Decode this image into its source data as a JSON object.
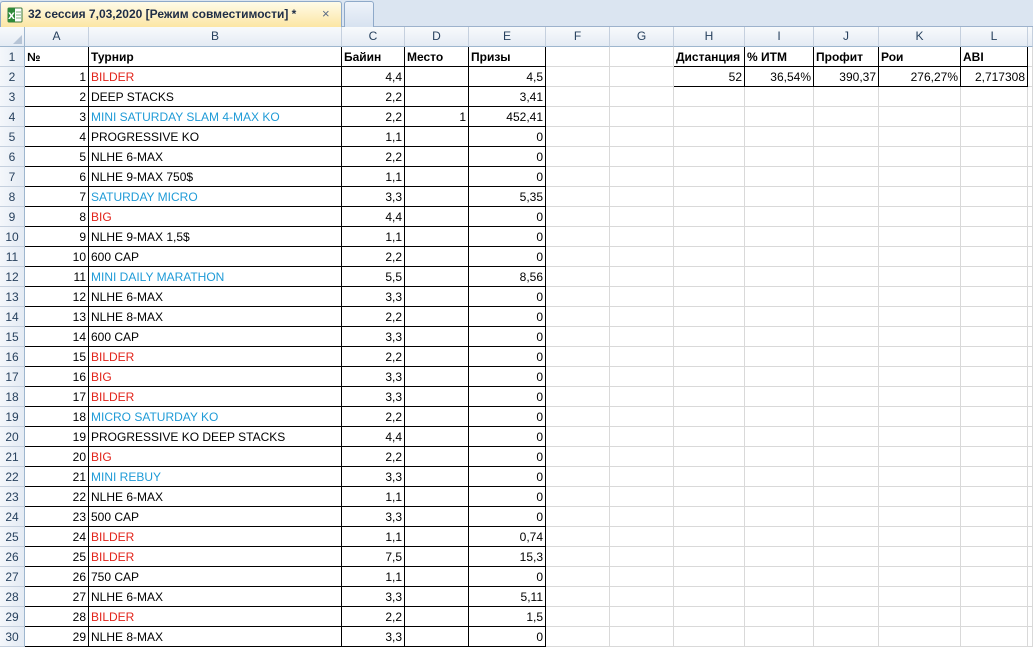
{
  "window": {
    "tab_title": "32 сессия 7,03,2020  [Режим совместимости] *",
    "close_glyph": "×"
  },
  "columns": [
    "A",
    "B",
    "C",
    "D",
    "E",
    "F",
    "G",
    "H",
    "I",
    "J",
    "K",
    "L"
  ],
  "row_numbers": [
    "1",
    "2",
    "3",
    "4",
    "5",
    "6",
    "7",
    "8",
    "9",
    "10",
    "11",
    "12",
    "13",
    "14",
    "15",
    "16",
    "17",
    "18",
    "19",
    "20",
    "21",
    "22",
    "23",
    "24",
    "25",
    "26",
    "27",
    "28",
    "29",
    "30"
  ],
  "table": {
    "headers": [
      "№",
      "Турнир",
      "Байин",
      "Место",
      "Призы"
    ],
    "rows": [
      {
        "n": "1",
        "name": "BILDER",
        "color": "red",
        "buyin": "4,4",
        "place": "",
        "prize": "4,5"
      },
      {
        "n": "2",
        "name": "DEEP STACKS",
        "color": "black",
        "buyin": "2,2",
        "place": "",
        "prize": "3,41"
      },
      {
        "n": "3",
        "name": "MINI SATURDAY SLAM 4-MAX KO",
        "color": "blue",
        "buyin": "2,2",
        "place": "1",
        "prize": "452,41"
      },
      {
        "n": "4",
        "name": "PROGRESSIVE KO",
        "color": "black",
        "buyin": "1,1",
        "place": "",
        "prize": "0"
      },
      {
        "n": "5",
        "name": "NLHE 6-MAX",
        "color": "black",
        "buyin": "2,2",
        "place": "",
        "prize": "0"
      },
      {
        "n": "6",
        "name": "NLHE 9-MAX 750$",
        "color": "black",
        "buyin": "1,1",
        "place": "",
        "prize": "0"
      },
      {
        "n": "7",
        "name": "SATURDAY MICRO",
        "color": "blue",
        "buyin": "3,3",
        "place": "",
        "prize": "5,35"
      },
      {
        "n": "8",
        "name": "BIG",
        "color": "red",
        "buyin": "4,4",
        "place": "",
        "prize": "0"
      },
      {
        "n": "9",
        "name": "NLHE 9-MAX 1,5$",
        "color": "black",
        "buyin": "1,1",
        "place": "",
        "prize": "0"
      },
      {
        "n": "10",
        "name": "600 CAP",
        "color": "black",
        "buyin": "2,2",
        "place": "",
        "prize": "0"
      },
      {
        "n": "11",
        "name": "MINI DAILY MARATHON",
        "color": "blue",
        "buyin": "5,5",
        "place": "",
        "prize": "8,56"
      },
      {
        "n": "12",
        "name": "NLHE 6-MAX",
        "color": "black",
        "buyin": "3,3",
        "place": "",
        "prize": "0"
      },
      {
        "n": "13",
        "name": "NLHE 8-MAX",
        "color": "black",
        "buyin": "2,2",
        "place": "",
        "prize": "0"
      },
      {
        "n": "14",
        "name": "600 CAP",
        "color": "black",
        "buyin": "3,3",
        "place": "",
        "prize": "0"
      },
      {
        "n": "15",
        "name": "BILDER",
        "color": "red",
        "buyin": "2,2",
        "place": "",
        "prize": "0"
      },
      {
        "n": "16",
        "name": "BIG",
        "color": "red",
        "buyin": "3,3",
        "place": "",
        "prize": "0"
      },
      {
        "n": "17",
        "name": "BILDER",
        "color": "red",
        "buyin": "3,3",
        "place": "",
        "prize": "0"
      },
      {
        "n": "18",
        "name": "MICRO SATURDAY KO",
        "color": "blue",
        "buyin": "2,2",
        "place": "",
        "prize": "0"
      },
      {
        "n": "19",
        "name": "PROGRESSIVE KO DEEP STACKS",
        "color": "black",
        "buyin": "4,4",
        "place": "",
        "prize": "0"
      },
      {
        "n": "20",
        "name": "BIG",
        "color": "red",
        "buyin": "2,2",
        "place": "",
        "prize": "0"
      },
      {
        "n": "21",
        "name": "MINI REBUY",
        "color": "blue",
        "buyin": "3,3",
        "place": "",
        "prize": "0"
      },
      {
        "n": "22",
        "name": "NLHE 6-MAX",
        "color": "black",
        "buyin": "1,1",
        "place": "",
        "prize": "0"
      },
      {
        "n": "23",
        "name": "500 CAP",
        "color": "black",
        "buyin": "3,3",
        "place": "",
        "prize": "0"
      },
      {
        "n": "24",
        "name": "BILDER",
        "color": "red",
        "buyin": "1,1",
        "place": "",
        "prize": "0,74"
      },
      {
        "n": "25",
        "name": "BILDER",
        "color": "red",
        "buyin": "7,5",
        "place": "",
        "prize": "15,3"
      },
      {
        "n": "26",
        "name": "750 CAP",
        "color": "black",
        "buyin": "1,1",
        "place": "",
        "prize": "0"
      },
      {
        "n": "27",
        "name": "NLHE 6-MAX",
        "color": "black",
        "buyin": "3,3",
        "place": "",
        "prize": "5,11"
      },
      {
        "n": "28",
        "name": "BILDER",
        "color": "red",
        "buyin": "2,2",
        "place": "",
        "prize": "1,5"
      },
      {
        "n": "29",
        "name": "NLHE 8-MAX",
        "color": "black",
        "buyin": "3,3",
        "place": "",
        "prize": "0"
      }
    ]
  },
  "summary": {
    "headers": [
      "Дистанция",
      "% ИТМ",
      "Профит",
      "Рои",
      "ABI"
    ],
    "values": [
      "52",
      "36,54%",
      "390,37",
      "276,27%",
      "2,717308"
    ]
  },
  "colors": {
    "red": "#e2231a",
    "blue": "#1f9bd7",
    "header_bg": "#e4ebf4",
    "tab_active": "#fce6a4"
  },
  "icons": {
    "file_icon": "excel-file-icon",
    "close_icon": "close-icon"
  }
}
